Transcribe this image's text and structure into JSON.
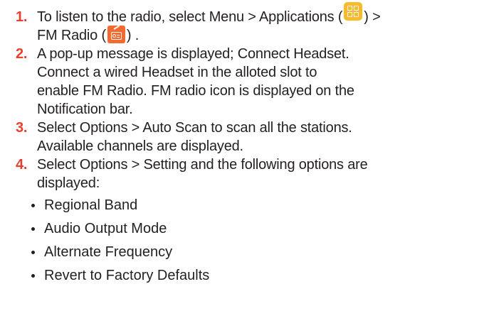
{
  "heading_fragment": "",
  "steps": [
    {
      "number": "1.",
      "parts": {
        "a": "To listen to the radio, select Menu > Applications (",
        "b": ") >",
        "c": "FM Radio (",
        "d": ") ."
      }
    },
    {
      "number": "2.",
      "lines": [
        "A pop-up message is displayed; Connect Headset.",
        "Connect a wired Headset in the alloted slot to",
        "enable FM Radio. FM radio icon is displayed on the",
        "Notification bar."
      ]
    },
    {
      "number": "3.",
      "lines": [
        "Select Options > Auto Scan to scan all the stations.",
        "Available channels are displayed."
      ]
    },
    {
      "number": "4.",
      "lines": [
        "Select Options > Setting and the following options are",
        "displayed:"
      ],
      "options": [
        "Regional Band",
        "Audio Output Mode",
        "Alternate Frequency",
        "Revert to Factory Defaults"
      ]
    }
  ],
  "icons": {
    "applications": "applications-grid-icon",
    "fm_radio": "fm-radio-icon"
  },
  "colors": {
    "step_number": "#e8402f",
    "applications_icon": "#f6ba2a",
    "fm_radio_icon": "#f26a2f",
    "text": "#231f20"
  }
}
